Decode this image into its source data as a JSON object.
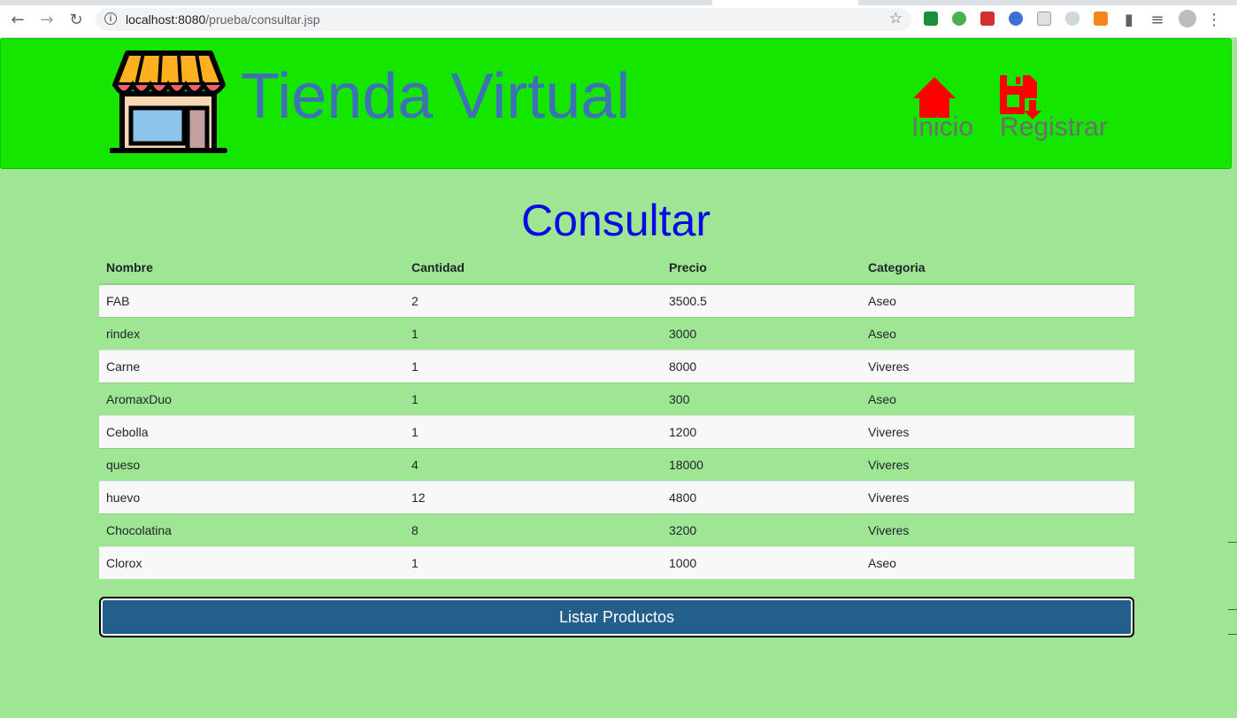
{
  "browser": {
    "url_host": "localhost:8080",
    "url_path": "/prueba/consultar.jsp",
    "back_icon": "arrow-left-icon",
    "forward_icon": "arrow-right-icon",
    "reload_icon": "reload-icon",
    "star_icon": "star-icon"
  },
  "header": {
    "title": "Tienda Virtual",
    "logo": "store-icon",
    "nav": [
      {
        "label": "Inicio",
        "icon": "home-icon"
      },
      {
        "label": "Registrar",
        "icon": "save-download-icon"
      }
    ]
  },
  "main": {
    "title": "Consultar",
    "columns": [
      "Nombre",
      "Cantidad",
      "Precio",
      "Categoria"
    ],
    "rows": [
      [
        "FAB",
        "2",
        "3500.5",
        "Aseo"
      ],
      [
        "rindex",
        "1",
        "3000",
        "Aseo"
      ],
      [
        "Carne",
        "1",
        "8000",
        "Viveres"
      ],
      [
        "AromaxDuo",
        "1",
        "300",
        "Aseo"
      ],
      [
        "Cebolla",
        "1",
        "1200",
        "Viveres"
      ],
      [
        "queso",
        "4",
        "18000",
        "Viveres"
      ],
      [
        "huevo",
        "12",
        "4800",
        "Viveres"
      ],
      [
        "Chocolatina",
        "8",
        "3200",
        "Viveres"
      ],
      [
        "Clorox",
        "1",
        "1000",
        "Aseo"
      ]
    ],
    "button_label": "Listar Productos"
  },
  "colors": {
    "header_bg": "#14e600",
    "page_bg": "#9ee693",
    "title_blue": "#0a0ae6",
    "brand_blue": "#3d72b4",
    "button_bg": "#245f8c",
    "nav_icon_red": "#ff0000"
  }
}
